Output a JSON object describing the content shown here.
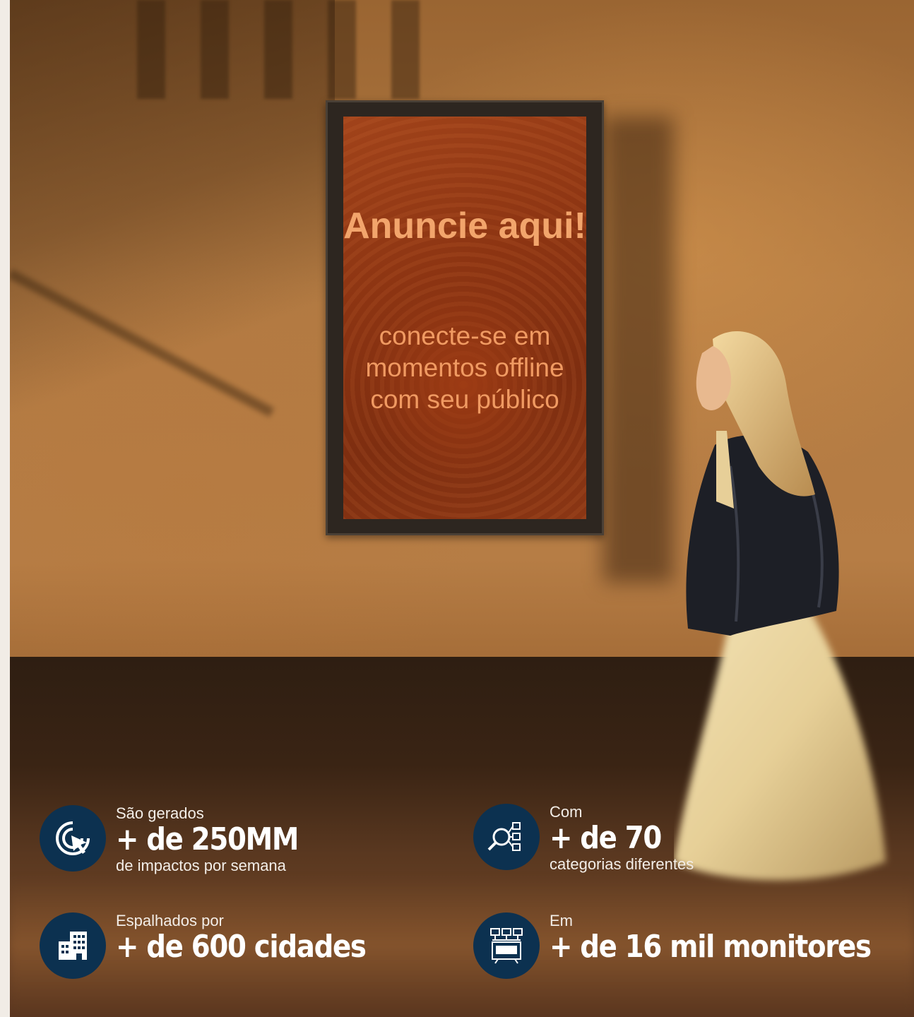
{
  "display": {
    "headline": "Anuncie aqui!",
    "subline": "conecte-se em momentos offline com seu público"
  },
  "stats": [
    {
      "pre": "São gerados",
      "big": "+ de 250MM",
      "post": "de impactos por semana",
      "icon": "cursor-click-icon"
    },
    {
      "pre": "Com",
      "big": "+ de 70",
      "post": "categorias diferentes",
      "icon": "search-categories-icon"
    },
    {
      "pre": "Espalhados por",
      "big": "+ de 600 cidades",
      "post": "",
      "icon": "buildings-icon"
    },
    {
      "pre": "Em",
      "big": "+ de 16 mil monitores",
      "post": "",
      "icon": "monitors-network-icon"
    }
  ],
  "colors": {
    "icon_circle": "#0c3150",
    "screen": "#8c3412",
    "screen_text": "#f2a56c"
  }
}
